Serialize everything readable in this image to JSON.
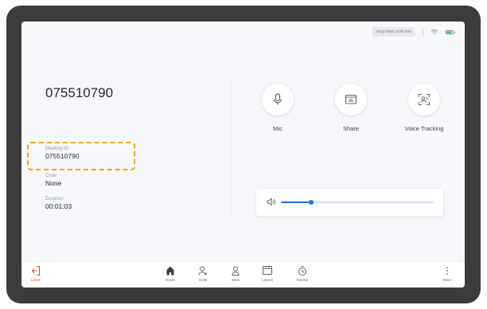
{
  "status_bar": {
    "label": "iacg daat szaf mw"
  },
  "conference": {
    "number": "075510790",
    "meeting_id_label": "Meeting ID",
    "meeting_id": "075510790",
    "chair_label": "Chair",
    "chair": "None",
    "duration_label": "Duration",
    "duration": "00:01:03"
  },
  "controls": [
    {
      "label": "Mic",
      "icon": "mic-icon"
    },
    {
      "label": "Share",
      "icon": "share-screen-icon"
    },
    {
      "label": "Voice Tracking",
      "icon": "voice-tracking-icon"
    }
  ],
  "volume": {
    "level_fraction": 0.2,
    "icon": "speaker-icon"
  },
  "toolbar": {
    "leave": "Leave",
    "home": "Home",
    "invite": "Invite",
    "sites": "Sites",
    "layout": "Layout",
    "extend": "Extend",
    "more": "More"
  },
  "colors": {
    "accent": "#1f6fdb",
    "highlight": "#f0a800",
    "leave": "#e5483b",
    "wifi_battery": "#2bb24c"
  }
}
